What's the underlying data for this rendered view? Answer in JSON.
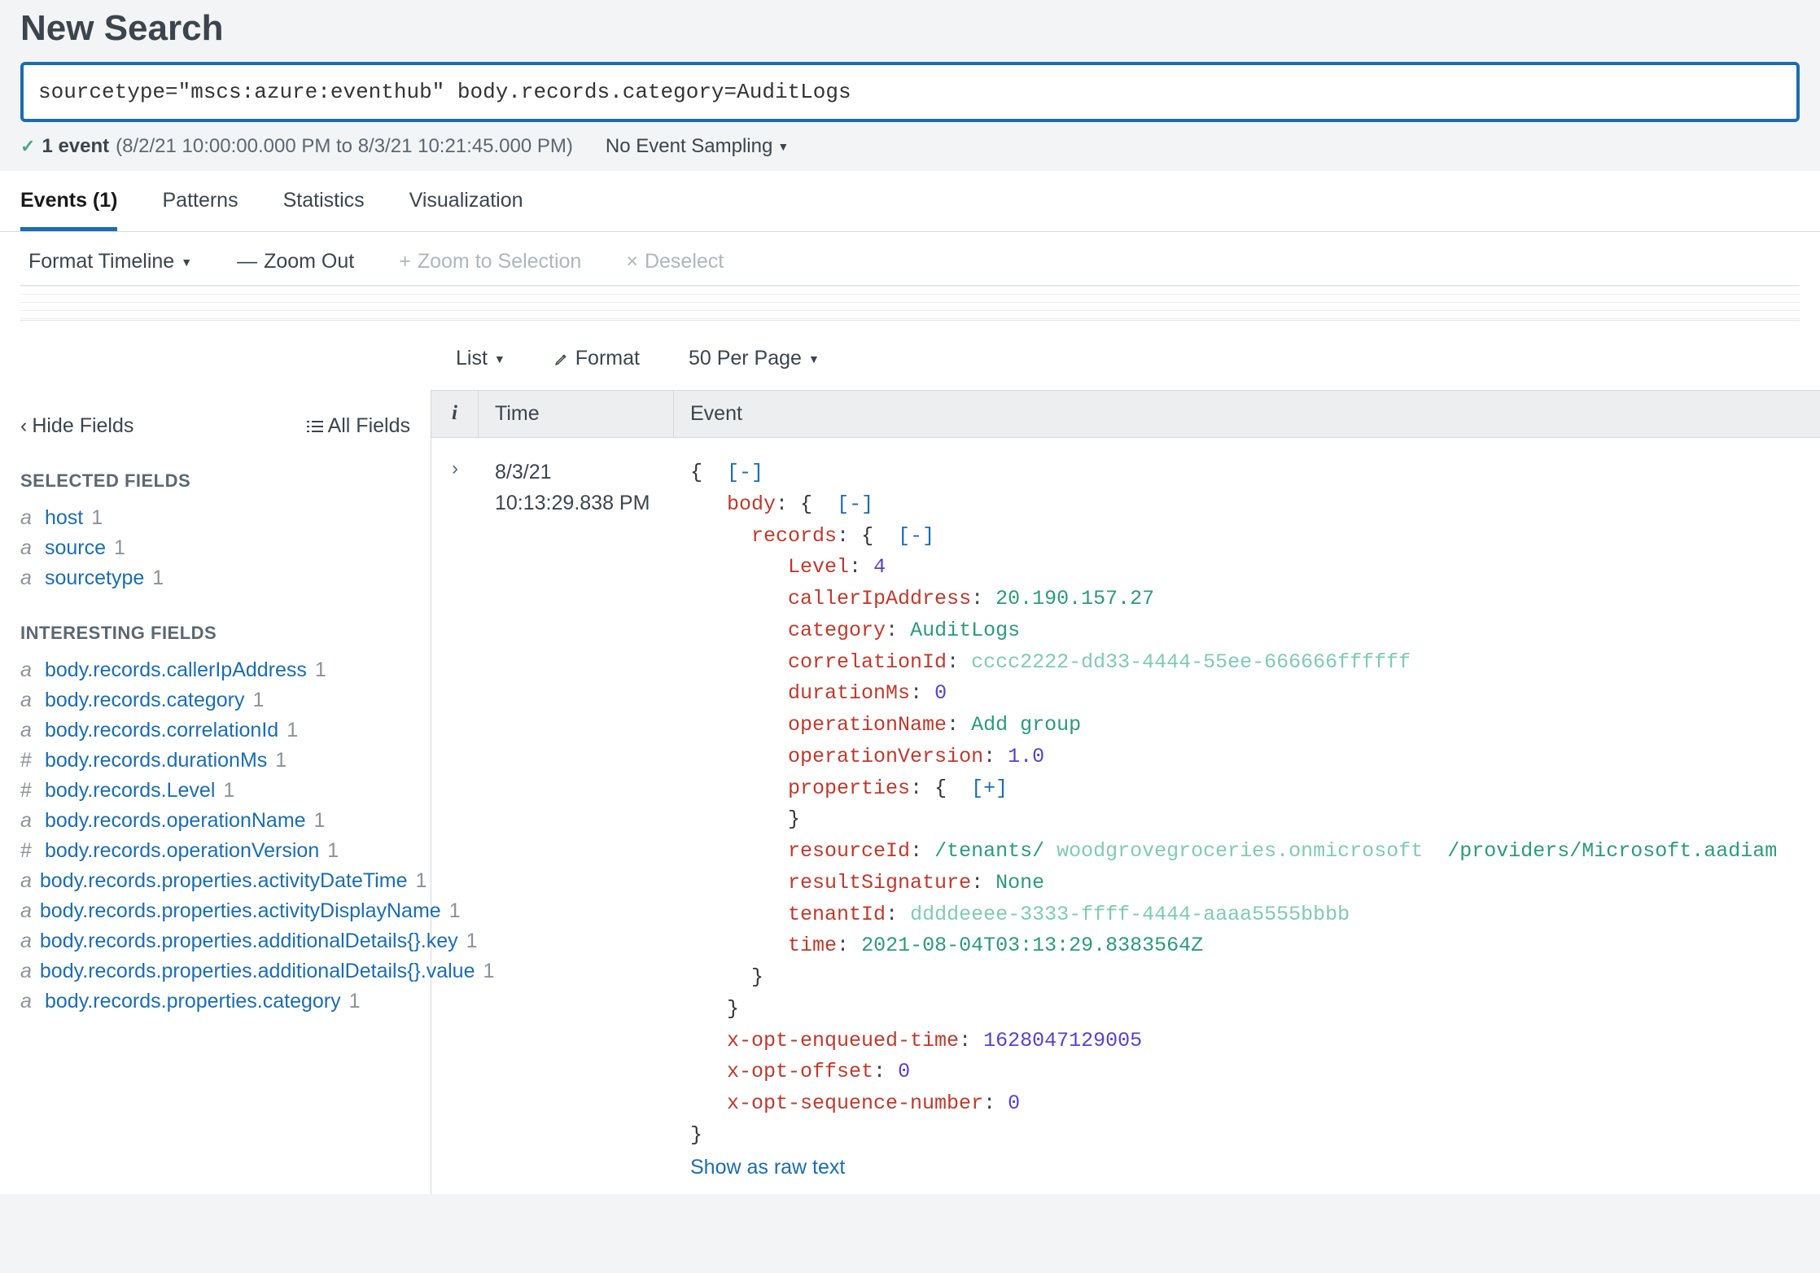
{
  "header": {
    "title": "New Search"
  },
  "search": {
    "query": "sourcetype=\"mscs:azure:eventhub\" body.records.category=AuditLogs"
  },
  "status": {
    "event_count_label": "1 event",
    "timerange": "(8/2/21 10:00:00.000 PM to 8/3/21 10:21:45.000 PM)",
    "sampling_label": "No Event Sampling"
  },
  "tabs": [
    {
      "label": "Events (1)",
      "active": true
    },
    {
      "label": "Patterns",
      "active": false
    },
    {
      "label": "Statistics",
      "active": false
    },
    {
      "label": "Visualization",
      "active": false
    }
  ],
  "timeline_controls": {
    "format": "Format Timeline",
    "zoom_out": "Zoom Out",
    "zoom_sel": "Zoom to Selection",
    "deselect": "Deselect"
  },
  "list_controls": {
    "list": "List",
    "format": "Format",
    "per_page": "50 Per Page"
  },
  "sidebar": {
    "hide_fields": "Hide Fields",
    "all_fields": "All Fields",
    "selected_title": "SELECTED FIELDS",
    "interesting_title": "INTERESTING FIELDS",
    "selected": [
      {
        "type": "a",
        "name": "host",
        "count": "1"
      },
      {
        "type": "a",
        "name": "source",
        "count": "1"
      },
      {
        "type": "a",
        "name": "sourcetype",
        "count": "1"
      }
    ],
    "interesting": [
      {
        "type": "a",
        "name": "body.records.callerIpAddress",
        "count": "1"
      },
      {
        "type": "a",
        "name": "body.records.category",
        "count": "1"
      },
      {
        "type": "a",
        "name": "body.records.correlationId",
        "count": "1"
      },
      {
        "type": "#",
        "name": "body.records.durationMs",
        "count": "1"
      },
      {
        "type": "#",
        "name": "body.records.Level",
        "count": "1"
      },
      {
        "type": "a",
        "name": "body.records.operationName",
        "count": "1"
      },
      {
        "type": "#",
        "name": "body.records.operationVersion",
        "count": "1"
      },
      {
        "type": "a",
        "name": "body.records.properties.activityDateTime",
        "count": "1"
      },
      {
        "type": "a",
        "name": "body.records.properties.activityDisplayName",
        "count": "1"
      },
      {
        "type": "a",
        "name": "body.records.properties.additionalDetails{}.key",
        "count": "1"
      },
      {
        "type": "a",
        "name": "body.records.properties.additionalDetails{}.value",
        "count": "1"
      },
      {
        "type": "a",
        "name": "body.records.properties.category",
        "count": "1"
      }
    ]
  },
  "table": {
    "col_info": "i",
    "col_time": "Time",
    "col_event": "Event"
  },
  "event": {
    "time_date": "8/3/21",
    "time_time": "10:13:29.838 PM",
    "records": {
      "Level": "4",
      "callerIpAddress": "20.190.157.27",
      "category": "AuditLogs",
      "correlationId": "cccc2222-dd33-4444-55ee-666666ffffff",
      "durationMs": "0",
      "operationName": "Add group",
      "operationVersion": "1.0",
      "resourceId_pre": "/tenants/",
      "resourceId_mid": "woodgrovegroceries.onmicrosoft",
      "resourceId_post": "/providers/Microsoft.aadiam",
      "resultSignature": "None",
      "tenantId": "ddddeeee-3333-ffff-4444-aaaa5555bbbb",
      "time": "2021-08-04T03:13:29.8383564Z"
    },
    "x_opt_enqueued_time": "1628047129005",
    "x_opt_offset": "0",
    "x_opt_sequence_number": "0",
    "show_raw": "Show as raw text"
  },
  "glyphs": {
    "caret_down": "▼",
    "chevron_left": "‹",
    "chevron_right": "›",
    "minus": "—",
    "plus": "+",
    "x": "×",
    "check": "✓",
    "collapse": "[-]",
    "expand": "[+]"
  }
}
